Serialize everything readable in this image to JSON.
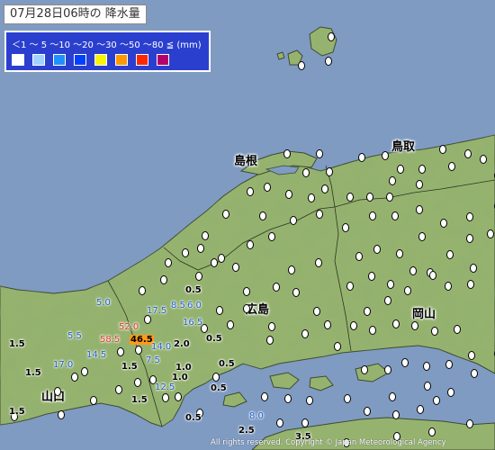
{
  "title": "07月28日06時の 降水量",
  "legend": {
    "scale_text": "＜1 ～ 5 ～10 ～20 ～30 ～50 ～80 ≦ (mm)",
    "colors": [
      "#ffffff",
      "#a0d2ff",
      "#2190ff",
      "#0041ff",
      "#faf500",
      "#ff9900",
      "#ff2800",
      "#b40068"
    ]
  },
  "places": {
    "shimane": "島根",
    "tottori": "鳥取",
    "hiroshima": "広島",
    "okayama": "岡山",
    "yamaguchi": "山口"
  },
  "station_values": [
    {
      "name": "v-5-0",
      "text": "5.0",
      "class": "blue"
    },
    {
      "name": "v-8-5",
      "text": "8.5",
      "class": "blue"
    },
    {
      "name": "v-6-0",
      "text": "6.0",
      "class": "blue"
    },
    {
      "name": "v-17-5",
      "text": "17.5",
      "class": "blue"
    },
    {
      "name": "v-0-5-a",
      "text": "0.5",
      "class": "black"
    },
    {
      "name": "v-16-5",
      "text": "16.5",
      "class": "blue"
    },
    {
      "name": "v-5-5",
      "text": "5.5",
      "class": "blue"
    },
    {
      "name": "v-52-0",
      "text": "52.0",
      "class": "red"
    },
    {
      "name": "v-58-5",
      "text": "58.5",
      "class": "red"
    },
    {
      "name": "v-46-5",
      "text": "46.5",
      "class": "orange"
    },
    {
      "name": "v-14-0",
      "text": "14.0",
      "class": "blue"
    },
    {
      "name": "v-2-0",
      "text": "2.0",
      "class": "black"
    },
    {
      "name": "v-0-5-b",
      "text": "0.5",
      "class": "black"
    },
    {
      "name": "v-1-5-a",
      "text": "1.5",
      "class": "black"
    },
    {
      "name": "v-14-5",
      "text": "14.5",
      "class": "blue"
    },
    {
      "name": "v-7-5",
      "text": "7.5",
      "class": "blue"
    },
    {
      "name": "v-17-0",
      "text": "17.0",
      "class": "blue"
    },
    {
      "name": "v-1-5-b",
      "text": "1.5",
      "class": "black"
    },
    {
      "name": "v-1-5-c",
      "text": "1.5",
      "class": "black"
    },
    {
      "name": "v-1-0-a",
      "text": "1.0",
      "class": "black"
    },
    {
      "name": "v-0-5-c",
      "text": "0.5",
      "class": "black"
    },
    {
      "name": "v-1-0-b",
      "text": "1.0",
      "class": "black"
    },
    {
      "name": "v-12-5",
      "text": "12.5",
      "class": "blue"
    },
    {
      "name": "v-0-5-d",
      "text": "0.5",
      "class": "black"
    },
    {
      "name": "v-1-5-d",
      "text": "1.5",
      "class": "black"
    },
    {
      "name": "v-1-5-e",
      "text": "1.5",
      "class": "black"
    },
    {
      "name": "v-0-5-e",
      "text": "0.5",
      "class": "black"
    },
    {
      "name": "v-8-0",
      "text": "8.0",
      "class": "blue"
    },
    {
      "name": "v-2-5",
      "text": "2.5",
      "class": "black"
    },
    {
      "name": "v-3-5",
      "text": "3.5",
      "class": "black"
    }
  ],
  "copyright": "All rights reserved. Copyright © Japan Meteorological Agency"
}
